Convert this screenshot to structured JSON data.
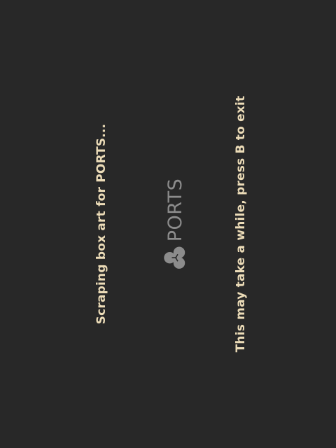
{
  "screen": {
    "status_text": "Scraping box art for PORTS...",
    "hint_text": "This may take a while, press B to exit",
    "logo": {
      "text": "PORTS",
      "icon": "ports-logo-icon",
      "color": "#8c8c8c"
    }
  },
  "colors": {
    "background": "#282828",
    "text": "#ecdcb8"
  }
}
